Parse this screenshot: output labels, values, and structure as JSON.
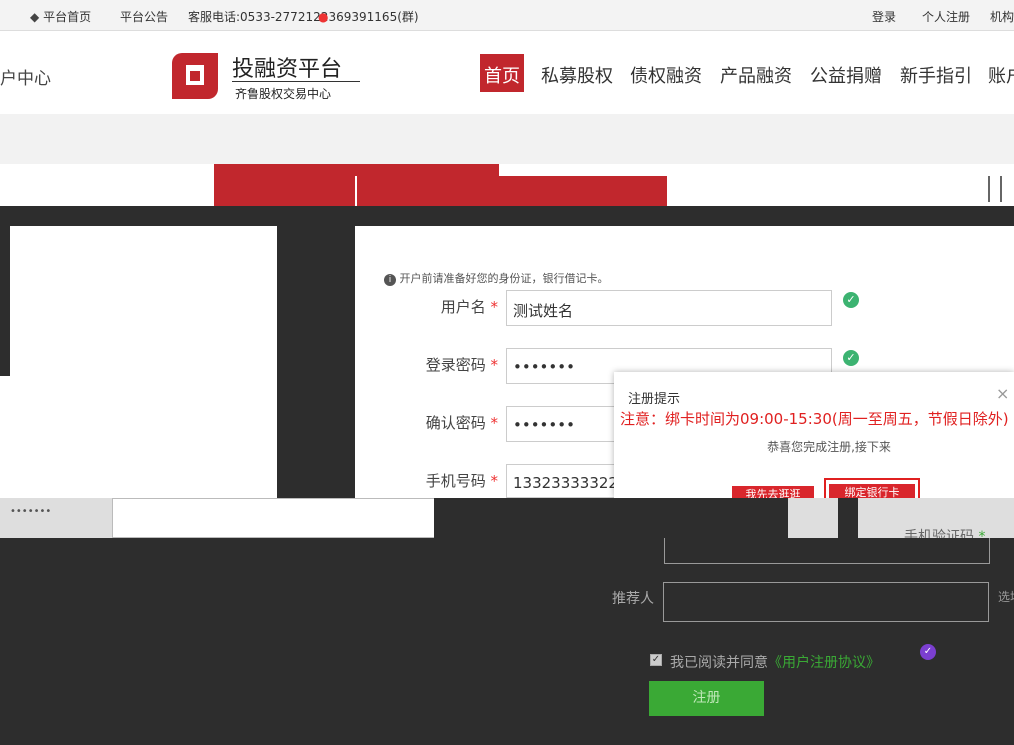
{
  "topbar": {
    "home": "平台首页",
    "notice": "平台公告",
    "phone": "客服电话:0533-2772122",
    "qq": "369391165(群)",
    "login": "登录",
    "register": "个人注册",
    "org": "机构"
  },
  "header": {
    "left_fragment": "户中心",
    "logo_title": "投融资平台",
    "logo_subtitle": "齐鲁股权交易中心"
  },
  "nav": {
    "items": [
      "首页",
      "私募股权",
      "债权融资",
      "产品融资",
      "公益捐赠",
      "新手指引",
      "账户"
    ]
  },
  "form": {
    "hint": "开户前请准备好您的身份证，银行借记卡。",
    "username_label": "用户名",
    "username_value": "测试姓名",
    "password_label": "登录密码",
    "password_value": "•••••••",
    "confirm_label": "确认密码",
    "confirm_value": "•••••••",
    "phone_label": "手机号码",
    "phone_value": "13323333322",
    "sms_label": "手机验证码",
    "referrer_label": "推荐人",
    "referrer_hint": "选填",
    "agree_text": "我已阅读并同意",
    "agree_link": "《用户注册协议》",
    "submit_label": "注册",
    "required_mark": "*"
  },
  "modal": {
    "title": "注册提示",
    "close": "×",
    "warning": "注意：绑卡时间为09:00-15:30(周一至周五，节假日除外)",
    "message": "恭喜您完成注册,接下来",
    "btn_later": "我先去逛逛",
    "btn_bind": "绑定银行卡"
  },
  "colors": {
    "accent_red": "#c1272d",
    "dark_bg": "#2d2d2d",
    "green": "#3aa935"
  }
}
